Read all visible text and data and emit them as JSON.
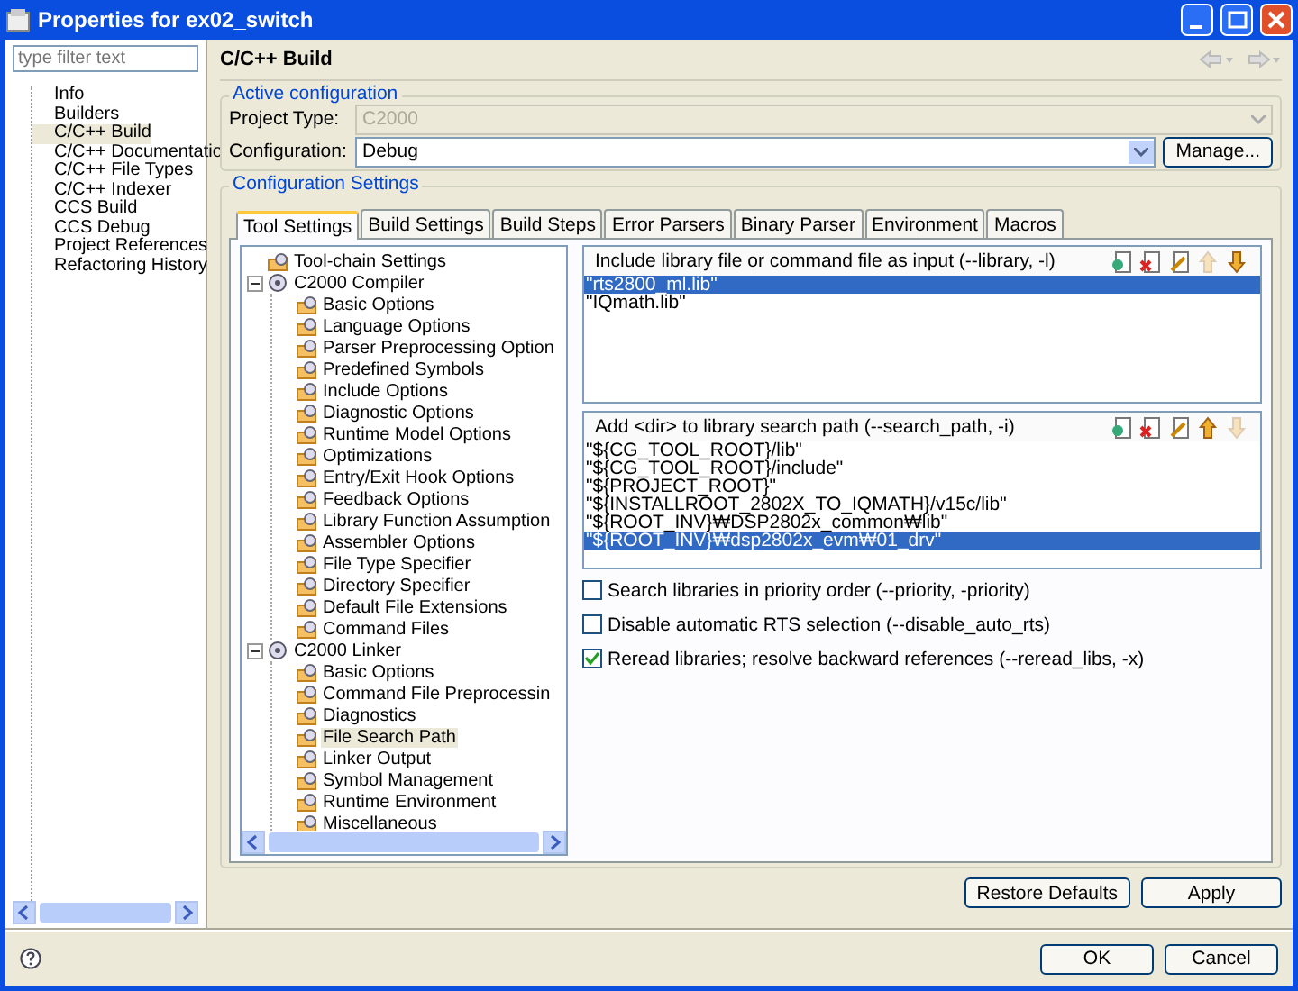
{
  "window": {
    "title": "Properties for ex02_switch"
  },
  "filter": {
    "placeholder": "type filter text"
  },
  "sidebar": {
    "items": [
      {
        "label": "Info",
        "selected": false
      },
      {
        "label": "Builders",
        "selected": false
      },
      {
        "label": "C/C++ Build",
        "selected": true
      },
      {
        "label": "C/C++ Documentatio",
        "selected": false
      },
      {
        "label": "C/C++ File Types",
        "selected": false
      },
      {
        "label": "C/C++ Indexer",
        "selected": false
      },
      {
        "label": "CCS Build",
        "selected": false
      },
      {
        "label": "CCS Debug",
        "selected": false
      },
      {
        "label": "Project References",
        "selected": false
      },
      {
        "label": "Refactoring History",
        "selected": false
      }
    ]
  },
  "page_title": "C/C++ Build",
  "active_configuration": {
    "title": "Active configuration",
    "project_type_label": "Project Type:",
    "project_type": "C2000",
    "configuration_label": "Configuration:",
    "configuration": "Debug",
    "manage_button": "Manage..."
  },
  "configuration_settings": {
    "title": "Configuration Settings",
    "tabs": [
      {
        "label": "Tool Settings",
        "selected": true
      },
      {
        "label": "Build Settings",
        "selected": false
      },
      {
        "label": "Build Steps",
        "selected": false
      },
      {
        "label": "Error Parsers",
        "selected": false
      },
      {
        "label": "Binary Parser",
        "selected": false
      },
      {
        "label": "Environment",
        "selected": false
      },
      {
        "label": "Macros",
        "selected": false
      }
    ],
    "tree": [
      {
        "label": "Tool-chain Settings",
        "kind": "option",
        "selected": false
      },
      {
        "label": "C2000 Compiler",
        "kind": "tool",
        "expanded": true,
        "selected": false,
        "children": [
          {
            "label": "Basic Options",
            "kind": "option",
            "selected": false
          },
          {
            "label": "Language Options",
            "kind": "option",
            "selected": false
          },
          {
            "label": "Parser Preprocessing Option",
            "kind": "option",
            "selected": false
          },
          {
            "label": "Predefined Symbols",
            "kind": "option",
            "selected": false
          },
          {
            "label": "Include Options",
            "kind": "option",
            "selected": false
          },
          {
            "label": "Diagnostic Options",
            "kind": "option",
            "selected": false
          },
          {
            "label": "Runtime Model Options",
            "kind": "option",
            "selected": false
          },
          {
            "label": "Optimizations",
            "kind": "option",
            "selected": false
          },
          {
            "label": "Entry/Exit Hook Options",
            "kind": "option",
            "selected": false
          },
          {
            "label": "Feedback Options",
            "kind": "option",
            "selected": false
          },
          {
            "label": "Library Function Assumption",
            "kind": "option",
            "selected": false
          },
          {
            "label": "Assembler Options",
            "kind": "option",
            "selected": false
          },
          {
            "label": "File Type Specifier",
            "kind": "option",
            "selected": false
          },
          {
            "label": "Directory Specifier",
            "kind": "option",
            "selected": false
          },
          {
            "label": "Default File Extensions",
            "kind": "option",
            "selected": false
          },
          {
            "label": "Command Files",
            "kind": "option",
            "selected": false
          }
        ]
      },
      {
        "label": "C2000 Linker",
        "kind": "tool",
        "expanded": true,
        "selected": false,
        "children": [
          {
            "label": "Basic Options",
            "kind": "option",
            "selected": false
          },
          {
            "label": "Command File Preprocessin",
            "kind": "option",
            "selected": false
          },
          {
            "label": "Diagnostics",
            "kind": "option",
            "selected": false
          },
          {
            "label": "File Search Path",
            "kind": "option",
            "selected": true
          },
          {
            "label": "Linker Output",
            "kind": "option",
            "selected": false
          },
          {
            "label": "Symbol Management",
            "kind": "option",
            "selected": false
          },
          {
            "label": "Runtime Environment",
            "kind": "option",
            "selected": false
          },
          {
            "label": "Miscellaneous",
            "kind": "option",
            "selected": false
          }
        ]
      }
    ],
    "lists": [
      {
        "title": "Include library file or command file as input (--library, -l)",
        "tools": [
          {
            "kind": "add",
            "disabled": false
          },
          {
            "kind": "delete",
            "disabled": false
          },
          {
            "kind": "edit",
            "disabled": false
          },
          {
            "kind": "up",
            "disabled": true
          },
          {
            "kind": "down",
            "disabled": false
          }
        ],
        "items": [
          {
            "text": "\"rts2800_ml.lib\"",
            "selected": true
          },
          {
            "text": "\"IQmath.lib\"",
            "selected": false
          }
        ]
      },
      {
        "title": "Add <dir> to library search path (--search_path, -i)",
        "tools": [
          {
            "kind": "add",
            "disabled": false
          },
          {
            "kind": "delete",
            "disabled": false
          },
          {
            "kind": "edit",
            "disabled": false
          },
          {
            "kind": "up",
            "disabled": false
          },
          {
            "kind": "down",
            "disabled": true
          }
        ],
        "items": [
          {
            "text": "\"${CG_TOOL_ROOT}/lib\"",
            "selected": false
          },
          {
            "text": "\"${CG_TOOL_ROOT}/include\"",
            "selected": false
          },
          {
            "text": "\"${PROJECT_ROOT}\"",
            "selected": false
          },
          {
            "text": "\"${INSTALLROOT_2802X_TO_IQMATH}/v15c/lib\"",
            "selected": false
          },
          {
            "text": "\"${ROOT_INV}₩DSP2802x_common₩lib\"",
            "selected": false
          },
          {
            "text": "\"${ROOT_INV}₩dsp2802x_evm₩01_drv\"",
            "selected": true
          }
        ]
      }
    ],
    "checkboxes": [
      {
        "label": "Search libraries in priority order (--priority, -priority)",
        "checked": false
      },
      {
        "label": "Disable automatic RTS selection (--disable_auto_rts)",
        "checked": false
      },
      {
        "label": "Reread libraries; resolve backward references (--reread_libs, -x)",
        "checked": true
      }
    ]
  },
  "page_buttons": [
    "Restore Defaults",
    "Apply"
  ],
  "dialog_buttons": [
    "OK",
    "Cancel"
  ]
}
